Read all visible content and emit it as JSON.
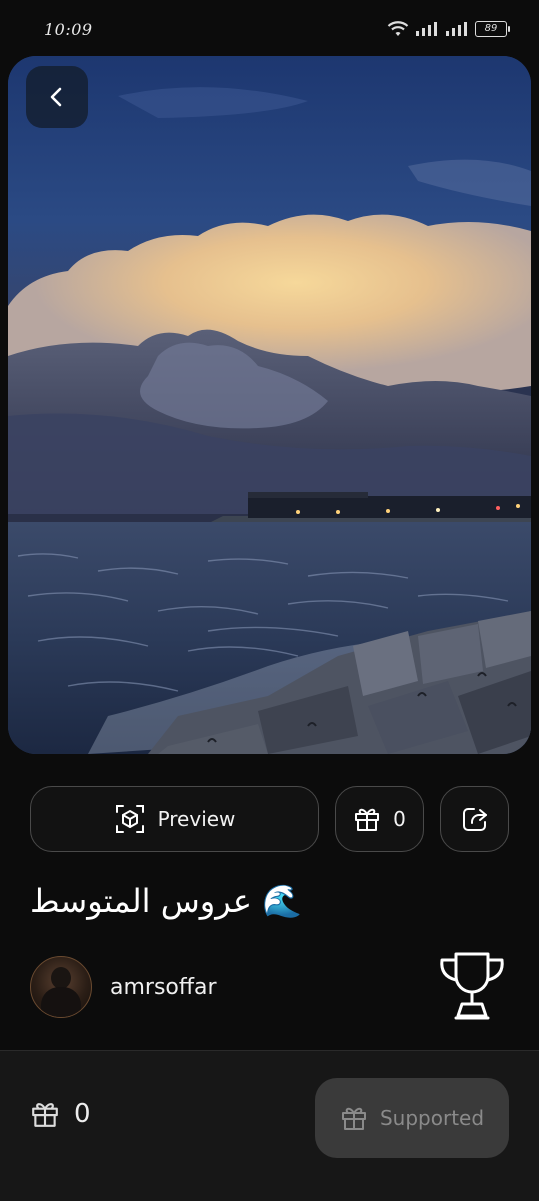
{
  "status_bar": {
    "time": "10:09",
    "battery": "89",
    "icons": [
      "wifi-icon",
      "signal-icon",
      "signal-icon",
      "battery-icon"
    ]
  },
  "hero": {
    "icon": "back-arrow-icon"
  },
  "actions": {
    "preview_label": "Preview",
    "preview_icon": "ar-cube-icon",
    "gift_count": "0",
    "gift_icon": "gift-icon",
    "share_icon": "share-icon"
  },
  "post": {
    "title": "عروس المتوسط",
    "title_emoji": "🌊"
  },
  "creator": {
    "username": "amrsoffar",
    "badge_icon": "trophy-icon"
  },
  "bottom_bar": {
    "gift_count": "0",
    "supported_label": "Supported"
  },
  "colors": {
    "background": "#0c0c0c",
    "button_border": "#4a4a4a",
    "supported_bg": "#3a3a3a",
    "supported_text": "#8a8a8a"
  }
}
